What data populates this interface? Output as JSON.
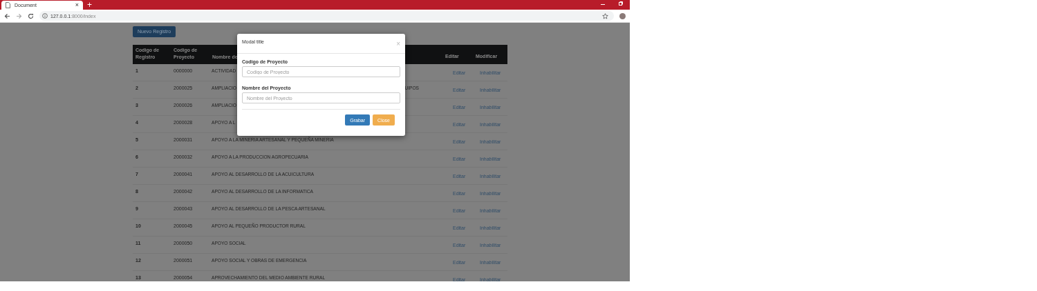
{
  "browser": {
    "tab_title": "Document",
    "tab_close": "×",
    "new_tab": "+",
    "url": {
      "host": "127.0.0.1",
      "path": ":8000/index"
    }
  },
  "page": {
    "new_button": "Nuevo Registro",
    "table": {
      "columns": [
        "Codigo de Registro",
        "Codigo de Proyecto",
        "Nombre de",
        "Editar",
        "Modificar"
      ],
      "rows": [
        {
          "id": "1",
          "code": "0000000",
          "name": "ACTIVIDAD",
          "name_tail": "",
          "edit": "Editar",
          "modify": "Inhabilitar"
        },
        {
          "id": "2",
          "code": "2000025",
          "name": "AMPLIACIO",
          "name_tail": "UIPOS",
          "edit": "Editar",
          "modify": "Inhabilitar"
        },
        {
          "id": "3",
          "code": "2000026",
          "name": "AMPLIACIO",
          "name_tail": "",
          "edit": "Editar",
          "modify": "Inhabilitar"
        },
        {
          "id": "4",
          "code": "2000028",
          "name": "APOYO A L",
          "name_tail": "",
          "edit": "Editar",
          "modify": "Inhabilitar"
        },
        {
          "id": "5",
          "code": "2000031",
          "name": "APOYO A LA MINERIA ARTESANAL Y PEQUEÑA MINERIA",
          "name_tail": "",
          "edit": "Editar",
          "modify": "Inhabilitar"
        },
        {
          "id": "6",
          "code": "2000032",
          "name": "APOYO A LA PRODUCCION AGROPECUARIA",
          "name_tail": "",
          "edit": "Editar",
          "modify": "Inhabilitar"
        },
        {
          "id": "7",
          "code": "2000041",
          "name": "APOYO AL DESARROLLO DE LA ACUICULTURA",
          "name_tail": "",
          "edit": "Editar",
          "modify": "Inhabilitar"
        },
        {
          "id": "8",
          "code": "2000042",
          "name": "APOYO AL DESARROLLO DE LA INFORMATICA",
          "name_tail": "",
          "edit": "Editar",
          "modify": "Inhabilitar"
        },
        {
          "id": "9",
          "code": "2000043",
          "name": "APOYO AL DESARROLLO DE LA PESCA ARTESANAL",
          "name_tail": "",
          "edit": "Editar",
          "modify": "Inhabilitar"
        },
        {
          "id": "10",
          "code": "2000045",
          "name": "APOYO AL PEQUEÑO PRODUCTOR RURAL",
          "name_tail": "",
          "edit": "Editar",
          "modify": "Inhabilitar"
        },
        {
          "id": "11",
          "code": "2000050",
          "name": "APOYO SOCIAL",
          "name_tail": "",
          "edit": "Editar",
          "modify": "Inhabilitar"
        },
        {
          "id": "12",
          "code": "2000051",
          "name": "APOYO SOCIAL Y OBRAS DE EMERGENCIA",
          "name_tail": "",
          "edit": "Editar",
          "modify": "Inhabilitar"
        },
        {
          "id": "13",
          "code": "2000054",
          "name": "APROVECHAMIENTO DEL MEDIO AMBIENTE RURAL",
          "name_tail": "",
          "edit": "Editar",
          "modify": "Inhabilitar"
        }
      ]
    }
  },
  "modal": {
    "title": "Modal title",
    "close": "×",
    "fields": [
      {
        "label": "Codigo de Proyecto",
        "placeholder": "Codigo de Proyecto"
      },
      {
        "label": "Nombre del Proyecto",
        "placeholder": "Nombre del Proyecto"
      }
    ],
    "buttons": [
      {
        "label": "Grabar",
        "kind": "primary"
      },
      {
        "label": "Close",
        "kind": "warning"
      }
    ]
  }
}
